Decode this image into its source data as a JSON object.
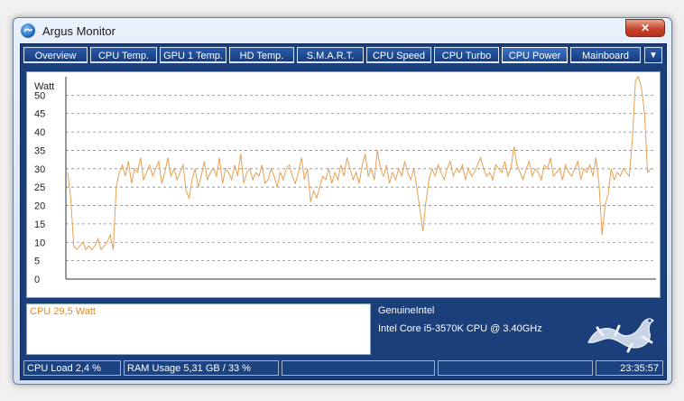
{
  "window": {
    "title": "Argus Monitor",
    "close_label": "✕"
  },
  "tabs": [
    {
      "label": "Overview",
      "active": false
    },
    {
      "label": "CPU Temp.",
      "active": false
    },
    {
      "label": "GPU 1 Temp.",
      "active": false
    },
    {
      "label": "HD Temp.",
      "active": false
    },
    {
      "label": "S.M.A.R.T.",
      "active": false
    },
    {
      "label": "CPU Speed",
      "active": false
    },
    {
      "label": "CPU Turbo",
      "active": false
    },
    {
      "label": "CPU Power",
      "active": true
    },
    {
      "label": "Mainboard",
      "active": false
    }
  ],
  "tabs_more_label": "▼",
  "info": {
    "reading": "CPU  29,5 Watt"
  },
  "cpu": {
    "vendor": "GenuineIntel",
    "model": "Intel Core i5-3570K CPU @ 3.40GHz"
  },
  "status": {
    "cpu_load": "CPU Load 2,4 %",
    "ram_usage": "RAM Usage 5,31 GB / 33 %",
    "time": "23:35:57"
  },
  "colors": {
    "series": "#e8a050",
    "grid": "#8a8a8a",
    "accent": "#1a3f7a"
  },
  "chart_data": {
    "type": "line",
    "ylabel": "Watt",
    "ylim": [
      0,
      55
    ],
    "yticks": [
      0,
      5,
      10,
      15,
      20,
      25,
      30,
      35,
      40,
      45,
      50
    ],
    "grid": "horizontal-dashed",
    "series": [
      {
        "values": [
          29,
          22,
          9,
          8,
          9,
          10,
          8,
          9,
          8,
          9,
          11,
          8,
          9,
          10,
          12,
          8,
          25,
          29,
          31,
          28,
          32,
          26,
          30,
          29,
          33,
          27,
          29,
          31,
          28,
          30,
          32,
          26,
          29,
          33,
          28,
          30,
          27,
          29,
          31,
          24,
          22,
          27,
          30,
          25,
          28,
          32,
          27,
          29,
          30,
          28,
          33,
          26,
          30,
          29,
          27,
          31,
          28,
          34,
          26,
          29,
          30,
          27,
          29,
          28,
          31,
          26,
          27,
          30,
          28,
          25,
          29,
          27,
          30,
          31,
          28,
          26,
          29,
          33,
          27,
          30,
          21,
          24,
          22,
          25,
          28,
          27,
          30,
          26,
          29,
          27,
          31,
          28,
          33,
          30,
          27,
          29,
          26,
          31,
          34,
          28,
          30,
          27,
          35,
          30,
          28,
          31,
          26,
          29,
          27,
          30,
          28,
          32,
          29,
          27,
          30,
          25,
          19,
          13,
          21,
          27,
          30,
          28,
          31,
          29,
          27,
          30,
          32,
          28,
          30,
          29,
          31,
          27,
          30,
          28,
          29,
          31,
          33,
          30,
          28,
          29,
          27,
          31,
          30,
          29,
          32,
          28,
          30,
          36,
          31,
          29,
          27,
          30,
          32,
          28,
          30,
          29,
          27,
          31,
          30,
          33,
          28,
          29,
          30,
          27,
          31,
          29,
          28,
          30,
          32,
          27,
          30,
          29,
          31,
          28,
          33,
          26,
          12,
          20,
          23,
          30,
          27,
          29,
          28,
          30,
          29,
          28,
          38,
          54,
          55,
          52,
          45,
          29,
          30
        ]
      }
    ]
  }
}
